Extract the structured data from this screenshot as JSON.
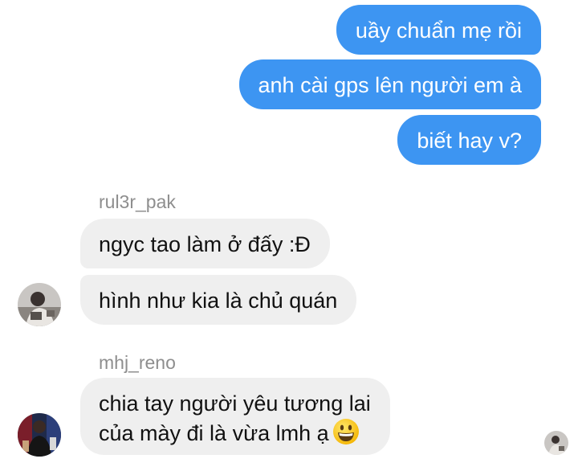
{
  "conversation": {
    "outgoing": [
      {
        "text": "uầy chuẩn mẹ rồi"
      },
      {
        "text": "anh cài gps lên người em à"
      },
      {
        "text": "biết hay v?"
      }
    ],
    "groups": [
      {
        "sender": "rul3r_pak",
        "messages": [
          {
            "text": "ngyc tao làm ở đấy :Đ"
          },
          {
            "text": "hình như kia là chủ quán"
          }
        ]
      },
      {
        "sender": "mhj_reno",
        "messages": [
          {
            "line1": "chia tay người yêu tương lai",
            "line2": "của mày đi là vừa lmh ạ",
            "emoji": "grinning-face-emoji"
          }
        ]
      }
    ]
  },
  "colors": {
    "outgoing_bubble": "#3d95f2",
    "incoming_bubble": "#efefef",
    "sender_name": "#8e8e8e"
  }
}
